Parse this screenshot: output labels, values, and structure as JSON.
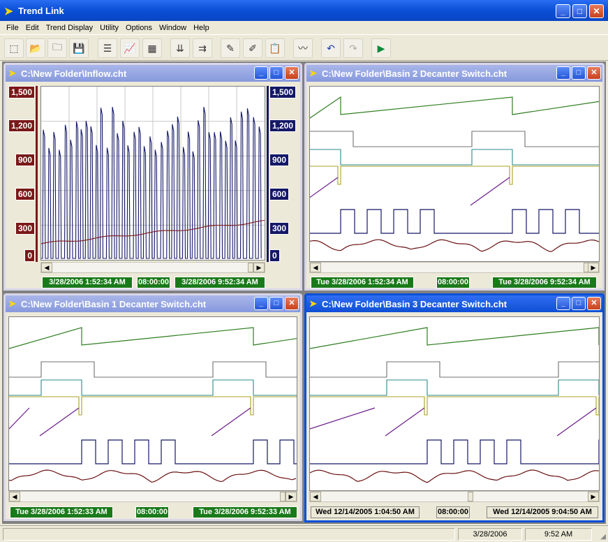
{
  "app": {
    "title": "Trend Link"
  },
  "menu": [
    "File",
    "Edit",
    "Trend Display",
    "Utility",
    "Options",
    "Window",
    "Help"
  ],
  "toolbar": [
    {
      "icon": "new-chart-icon"
    },
    {
      "icon": "open-folder-icon"
    },
    {
      "icon": "folder-icon"
    },
    {
      "icon": "save-icon"
    },
    {
      "icon": "trend-settings-icon"
    },
    {
      "icon": "trend-channels-icon"
    },
    {
      "icon": "grid-table-icon"
    },
    {
      "icon": "import-data-icon"
    },
    {
      "icon": "export-data-icon"
    },
    {
      "icon": "edit-pen-icon"
    },
    {
      "icon": "annotate-icon"
    },
    {
      "icon": "report-icon"
    },
    {
      "icon": "chart-view-icon"
    },
    {
      "icon": "undo-icon"
    },
    {
      "icon": "redo-icon"
    },
    {
      "icon": "play-icon"
    }
  ],
  "windows": {
    "inflow": {
      "title": "C:\\New Folder\\Inflow.cht",
      "y_left": [
        "1,500",
        "1,200",
        "900",
        "600",
        "300",
        "0"
      ],
      "y_right": [
        "1,500",
        "1,200",
        "900",
        "600",
        "300",
        "0"
      ],
      "start": "3/28/2006  1:52:34 AM",
      "span": "08:00:00",
      "end": "3/28/2006  9:52:34 AM"
    },
    "basin2": {
      "title": "C:\\New Folder\\Basin 2 Decanter Switch.cht",
      "start": "Tue 3/28/2006  1:52:34 AM",
      "span": "08:00:00",
      "end": "Tue 3/28/2006  9:52:34 AM"
    },
    "basin1": {
      "title": "C:\\New Folder\\Basin 1 Decanter Switch.cht",
      "start": "Tue 3/28/2006  1:52:33 AM",
      "span": "08:00:00",
      "end": "Tue 3/28/2006  9:52:33 AM"
    },
    "basin3": {
      "title": "C:\\New Folder\\Basin 3 Decanter Switch.cht",
      "start": "Wed 12/14/2005  1:04:50 AM",
      "span": "08:00:00",
      "end": "Wed 12/14/2005  9:04:50 AM"
    }
  },
  "status": {
    "date": "3/28/2006",
    "time": "9:52 AM"
  },
  "colors": {
    "titlebar": "#0a4fd6",
    "green_time": "#1a7a1a",
    "flow_line": "#141866",
    "level_line": "#7a1818",
    "trace_green": "#2e7d1e",
    "trace_gray": "#707070",
    "trace_teal": "#2a8a8a",
    "trace_olive": "#a8a020",
    "trace_purple": "#6a1a8a",
    "trace_navy": "#141866",
    "trace_maroon": "#6a1010"
  }
}
